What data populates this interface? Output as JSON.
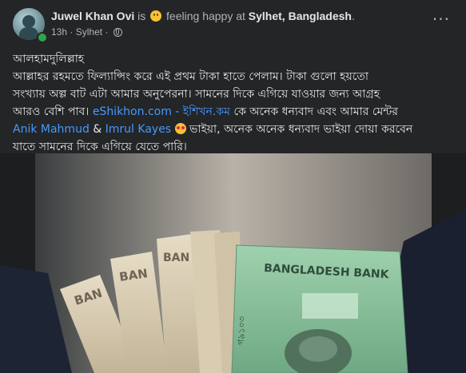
{
  "post": {
    "author": "Juwel Khan Ovi",
    "activity_is": "is",
    "activity_feeling": "feeling happy at",
    "location": "Sylhet, Bangladesh",
    "location_period": ".",
    "time": "13h",
    "separator": "·",
    "place": "Sylhet",
    "privacy_icon": "globe-icon",
    "more_icon": "ellipsis-icon",
    "more_label": "···",
    "text": {
      "line1": "আলহামদুলিল্লাহ",
      "line2": "আল্লাহর রহমতে ফিল্যান্সিং করে এই প্রথম টাকা হাতে পেলাম। টাকা গুলো হয়তো",
      "line3": "সংখ্যায় অল্প বাট এটা আমার অনুপেরনা। সামনের দিকে এগিয়ে যাওয়ার জন্য আগ্রহ",
      "line4_before": "আরও বেশি পাব। ",
      "line4_link": "eShikhon.com - ইশিখন.কম",
      "line4_after": "  কে অনেক ধন্যবাদ এবং আমার মেন্টর",
      "line5_link1": "Anik Mahmud",
      "line5_amp": "  & ",
      "line5_link2": "Imrul Kayes",
      "line5_after": " ভাইয়া,  অনেক অনেক ধন্যবাদ ভাইয়া দোয়া করবেন",
      "line6": "যাতে সামনের দিকে এগিয়ে যেতে পারি।"
    },
    "photo": {
      "description_icon": "banknotes-photo",
      "note_text_main": "BANGLADESH BANK",
      "note_text_partial": "BAN",
      "note_value_fragment": "গ৯১০৩",
      "accent_green": "#8fc4a0",
      "note_tan": "#d9cdb3"
    }
  },
  "colors": {
    "background": "#242526",
    "text": "#e4e6eb",
    "secondary": "#b0b3b8",
    "link": "#4599ff"
  }
}
